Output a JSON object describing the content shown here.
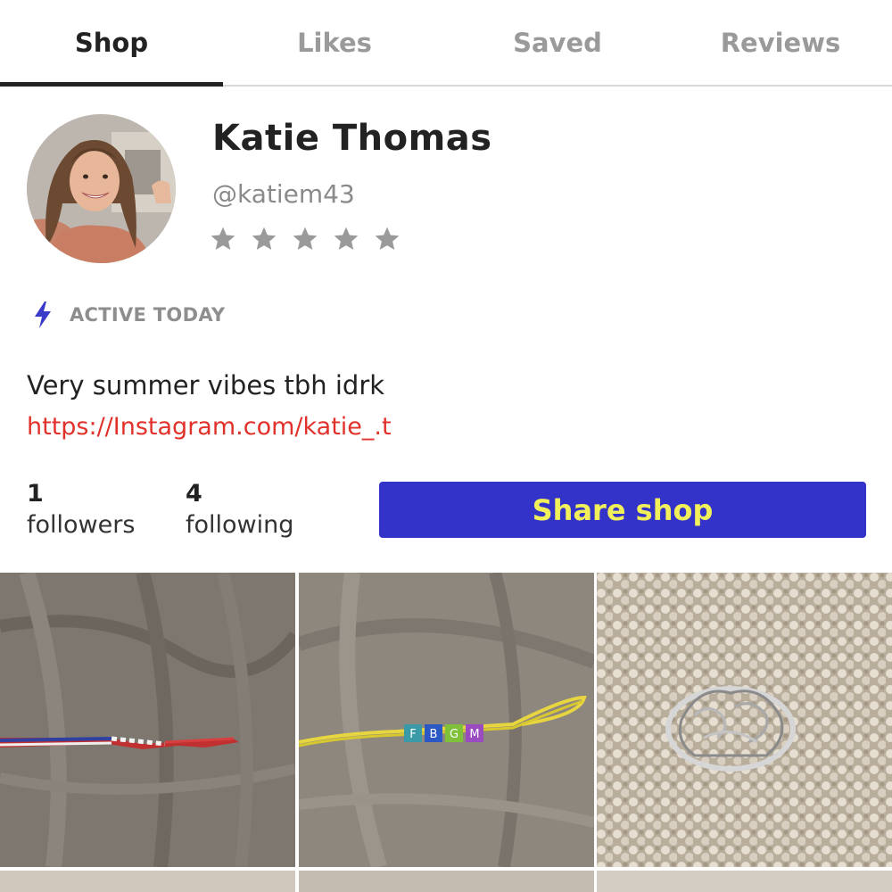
{
  "tabs": [
    {
      "label": "Shop",
      "active": true
    },
    {
      "label": "Likes",
      "active": false
    },
    {
      "label": "Saved",
      "active": false
    },
    {
      "label": "Reviews",
      "active": false
    }
  ],
  "profile": {
    "name": "Katie Thomas",
    "handle": "@katiem43",
    "rating_stars": 5,
    "rating_filled": 0,
    "active_status": "ACTIVE TODAY",
    "bio": "Very summer vibes tbh idrk",
    "link": "https://Instagram.com/katie_.t"
  },
  "stats": {
    "followers_count": "1",
    "followers_label": "followers",
    "following_count": "4",
    "following_label": "following"
  },
  "share_button": "Share shop",
  "colors": {
    "accent_blue": "#3333c9",
    "button_text_yellow": "#f2f05a",
    "link_red": "#e0322a",
    "bolt_blue": "#3a3ac8",
    "muted_gray": "#9a9a9a"
  },
  "listings": [
    {
      "description": "red white and blue braided bracelet"
    },
    {
      "description": "yellow braided bracelet with letter beads",
      "bead_letters": [
        "F",
        "B",
        "G",
        "M"
      ]
    },
    {
      "description": "silver elephant filigree ring on carpet"
    }
  ]
}
